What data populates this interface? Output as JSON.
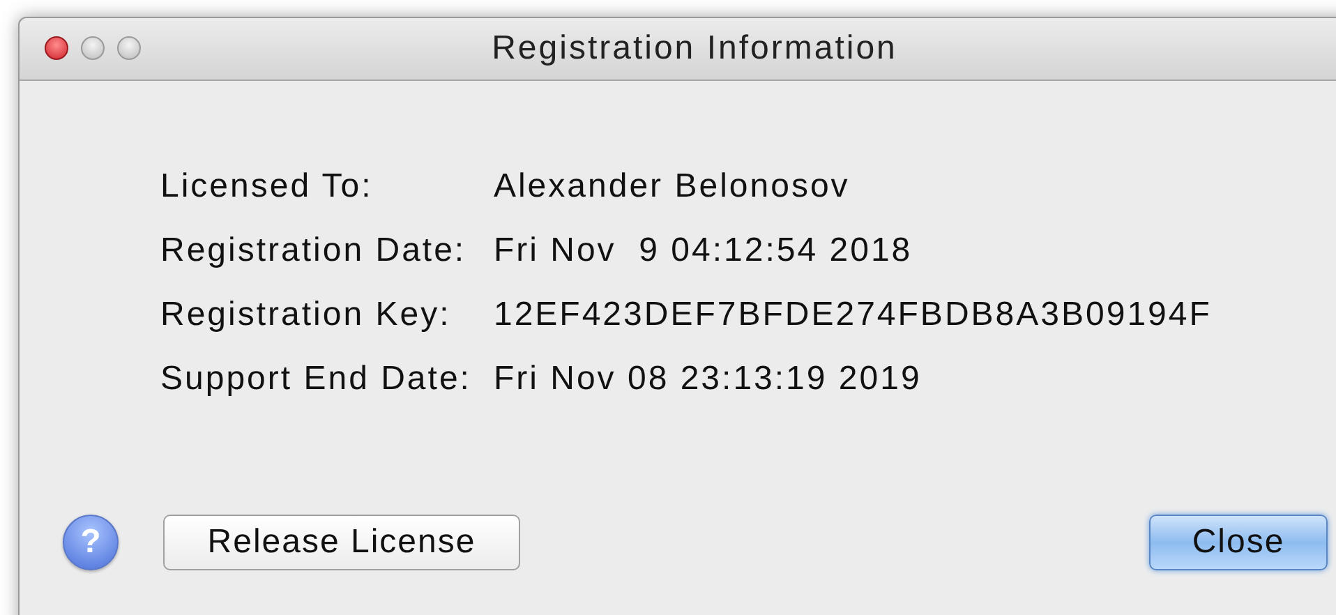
{
  "window": {
    "title": "Registration Information"
  },
  "fields": [
    {
      "label": "Licensed To:",
      "value": "Alexander Belonosov"
    },
    {
      "label": "Registration Date:",
      "value": "Fri Nov  9 04:12:54 2018"
    },
    {
      "label": "Registration Key:",
      "value": "12EF423DEF7BFDE274FBDB8A3B09194F"
    },
    {
      "label": "Support End Date:",
      "value": "Fri Nov 08 23:13:19 2019"
    }
  ],
  "help_button": {
    "label": "?"
  },
  "buttons": [
    {
      "label": "Release License",
      "kind": "normal"
    },
    {
      "label": "Close",
      "kind": "default"
    }
  ]
}
